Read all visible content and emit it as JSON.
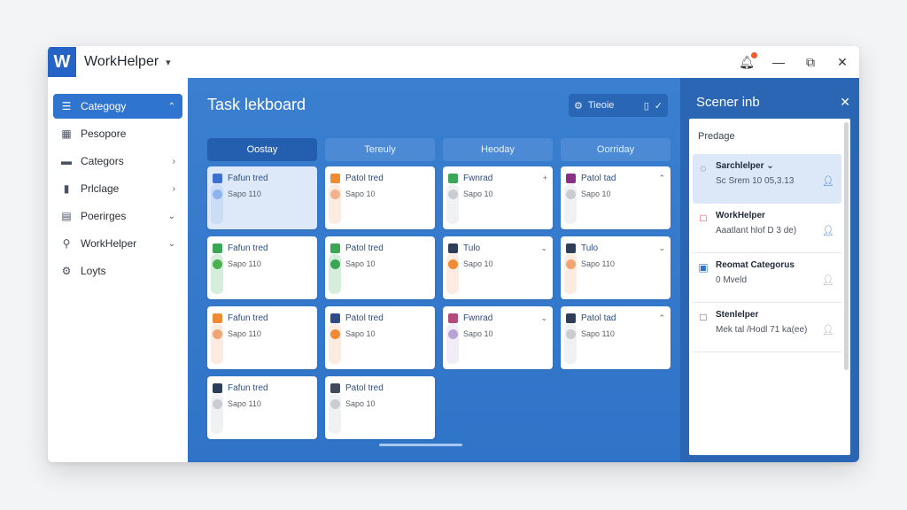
{
  "app": {
    "logo": "W",
    "title": "WorkHelper"
  },
  "titlebar": {
    "chevron_icon": "chevron-down-icon",
    "notify_icon": "bell-icon",
    "restore_icon": "restore-icon",
    "close_icon": "close-icon"
  },
  "sidebar": {
    "items": [
      {
        "label": "Categogy",
        "icon": "list-icon",
        "glyph": "☰",
        "chevron": "⌃",
        "active": true
      },
      {
        "label": "Pesopore",
        "icon": "grid-icon",
        "glyph": "▦",
        "chevron": ""
      },
      {
        "label": "Categors",
        "icon": "folder-icon",
        "glyph": "▬",
        "chevron": "›"
      },
      {
        "label": "Prlclage",
        "icon": "bar-chart-icon",
        "glyph": "▮",
        "chevron": "›"
      },
      {
        "label": "Poerirges",
        "icon": "document-icon",
        "glyph": "▤",
        "chevron": "⌄"
      },
      {
        "label": "WorkHelper",
        "icon": "search-icon",
        "glyph": "⚲",
        "chevron": "⌄"
      },
      {
        "label": "Loyts",
        "icon": "gear-icon",
        "glyph": "⚙",
        "chevron": ""
      }
    ]
  },
  "board": {
    "title": "Task lekboard",
    "toolbar_label": "Tieoie",
    "columns": [
      {
        "header": "Oostay",
        "cards": [
          {
            "title": "Fafun tred",
            "date": "Sapo 110",
            "badge": "#3b6fd1",
            "dot": "#8db3ee",
            "stripe": "#a8c5f0",
            "mark": ""
          },
          {
            "title": "Fafun tred",
            "date": "Sapo 110",
            "badge": "#3aa757",
            "dot": "#4caf50",
            "stripe": "#86cf97",
            "mark": ""
          },
          {
            "title": "Fafun tred",
            "date": "Sapo 110",
            "badge": "#f08a33",
            "dot": "#f0a574",
            "stripe": "#f6c7a5",
            "mark": ""
          },
          {
            "title": "Fafun tred",
            "date": "Sapo 110",
            "badge": "#2d3e5a",
            "dot": "#c9ccd1",
            "stripe": "#d5d8dd",
            "mark": ""
          }
        ]
      },
      {
        "header": "Tereuly",
        "cards": [
          {
            "title": "Patol tred",
            "date": "Sapo 10",
            "badge": "#f08a33",
            "dot": "#f3b08a",
            "stripe": "#f6c7a5",
            "mark": ""
          },
          {
            "title": "Patol tred",
            "date": "Sapo 10",
            "badge": "#3aa757",
            "dot": "#3aa757",
            "stripe": "#86cf97",
            "mark": ""
          },
          {
            "title": "Patol tred",
            "date": "Sapo 10",
            "badge": "#2d4c8a",
            "dot": "#f08a33",
            "stripe": "#f6c7a5",
            "mark": ""
          },
          {
            "title": "Patol tred",
            "date": "Sapo 10",
            "badge": "#3f4a5c",
            "dot": "#c9ccd1",
            "stripe": "#d5d8dd",
            "mark": ""
          }
        ]
      },
      {
        "header": "Heoday",
        "cards": [
          {
            "title": "Fwnrad",
            "date": "Sapo 10",
            "badge": "#3aa757",
            "dot": "#c9ccd1",
            "stripe": "#d5d8dd",
            "mark": "+"
          },
          {
            "title": "Tulo",
            "date": "Sapo 10",
            "badge": "#2d3e5a",
            "dot": "#f08a33",
            "stripe": "#f6c7a5",
            "mark": "⌄"
          },
          {
            "title": "Fwnrad",
            "date": "Sapo 10",
            "badge": "#b34a7a",
            "dot": "#b9a3d6",
            "stripe": "#d8cbe9",
            "mark": "⌄"
          }
        ]
      },
      {
        "header": "Oorriday",
        "cards": [
          {
            "title": "Patol tad",
            "date": "Sapo 10",
            "badge": "#8a2f86",
            "dot": "#c9ccd1",
            "stripe": "#d5d8dd",
            "mark": "⌃"
          },
          {
            "title": "Tulo",
            "date": "Sapo 110",
            "badge": "#2d3e5a",
            "dot": "#f0a574",
            "stripe": "#f6c7a5",
            "mark": "⌄"
          },
          {
            "title": "Patol tad",
            "date": "Sapo 110",
            "badge": "#2d3e5a",
            "dot": "#c9ccd1",
            "stripe": "#d5d8dd",
            "mark": "⌃"
          }
        ]
      }
    ]
  },
  "panel": {
    "title": "Scener inb",
    "section": "Predage",
    "items": [
      {
        "name": "Sarchlelper ⌄",
        "desc": "Sc Srem 10 05,3.13",
        "icon_glyph": "◌",
        "icon_color": "#4b5563",
        "user_muted": false,
        "selected": true
      },
      {
        "name": "WorkHelper",
        "desc": "Aaatlant hlof D 3 de)",
        "icon_glyph": "□",
        "icon_color": "#e23b3b",
        "user_muted": false,
        "selected": false
      },
      {
        "name": "Reomat Categorus",
        "desc": "0 Mveld",
        "icon_glyph": "▣",
        "icon_color": "#2f74cf",
        "user_muted": true,
        "selected": false
      },
      {
        "name": "Stenlelper",
        "desc": "Mek tal /Hodl 71 ka(ee)",
        "icon_glyph": "□",
        "icon_color": "#555",
        "user_muted": true,
        "selected": false
      }
    ]
  }
}
